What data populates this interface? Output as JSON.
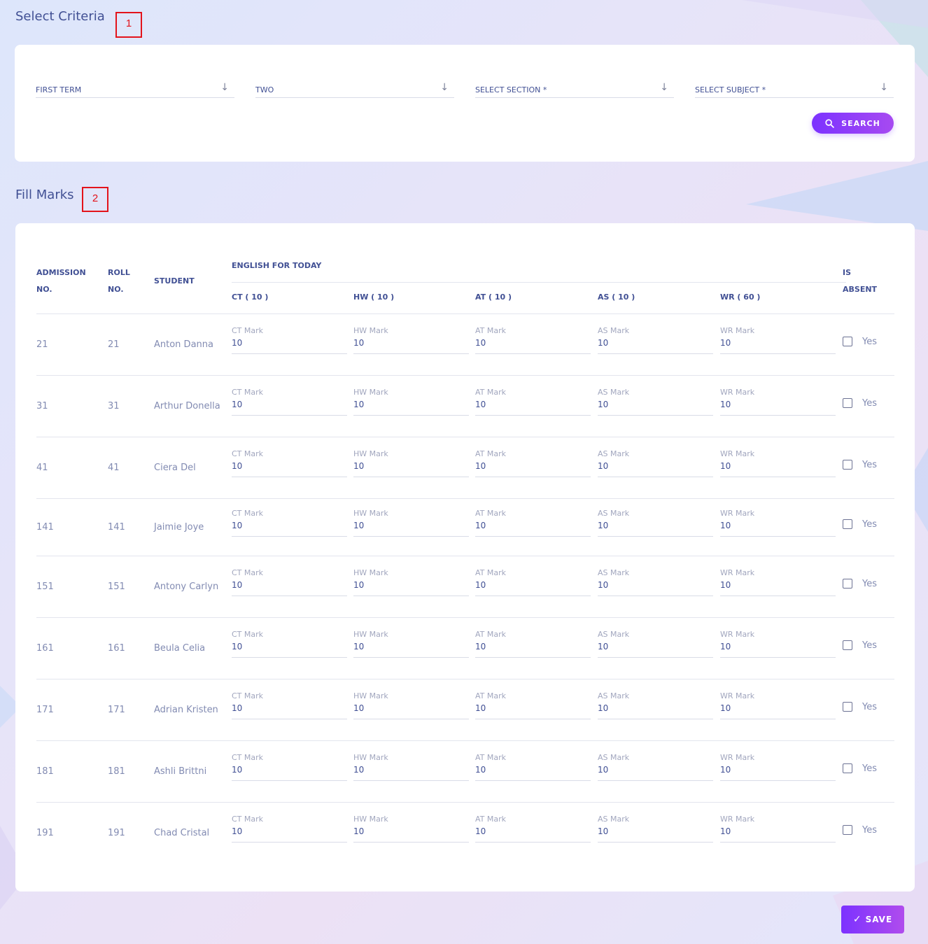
{
  "criteria": {
    "title": "Select Criteria",
    "annotation": "1",
    "exam": "FIRST TERM",
    "class": "TWO",
    "section": "SELECT SECTION *",
    "subject": "SELECT SUBJECT *",
    "search_label": "SEARCH"
  },
  "marks": {
    "title": "Fill Marks",
    "annotation": "2",
    "headers": {
      "admission_line1": "ADMISSION",
      "admission_line2": "NO.",
      "roll_line1": "ROLL",
      "roll_line2": "NO.",
      "student": "STUDENT",
      "subject_group": "ENGLISH FOR TODAY",
      "absent_line1": "IS",
      "absent_line2": "ABSENT",
      "parts": [
        "CT ( 10 )",
        "HW ( 10 )",
        "AT ( 10 )",
        "AS ( 10 )",
        "WR ( 60 )"
      ]
    },
    "part_labels": [
      "CT Mark",
      "HW Mark",
      "AT Mark",
      "AS Mark",
      "WR Mark"
    ],
    "yes_label": "Yes",
    "rows": [
      {
        "admission": "21",
        "roll": "21",
        "student": "Anton Danna",
        "values": [
          "10",
          "10",
          "10",
          "10",
          "10"
        ],
        "absent": false
      },
      {
        "admission": "31",
        "roll": "31",
        "student": "Arthur Donella",
        "values": [
          "10",
          "10",
          "10",
          "10",
          "10"
        ],
        "absent": false
      },
      {
        "admission": "41",
        "roll": "41",
        "student": "Ciera Del",
        "values": [
          "10",
          "10",
          "10",
          "10",
          "10"
        ],
        "absent": false
      },
      {
        "admission": "141",
        "roll": "141",
        "student": "Jaimie Joye",
        "values": [
          "10",
          "10",
          "10",
          "10",
          "10"
        ],
        "absent": false
      },
      {
        "admission": "151",
        "roll": "151",
        "student": "Antony Carlyn",
        "values": [
          "10",
          "10",
          "10",
          "10",
          "10"
        ],
        "absent": false
      },
      {
        "admission": "161",
        "roll": "161",
        "student": "Beula Celia",
        "values": [
          "10",
          "10",
          "10",
          "10",
          "10"
        ],
        "absent": false
      },
      {
        "admission": "171",
        "roll": "171",
        "student": "Adrian Kristen",
        "values": [
          "10",
          "10",
          "10",
          "10",
          "10"
        ],
        "absent": false
      },
      {
        "admission": "181",
        "roll": "181",
        "student": "Ashli Brittni",
        "values": [
          "10",
          "10",
          "10",
          "10",
          "10"
        ],
        "absent": false
      },
      {
        "admission": "191",
        "roll": "191",
        "student": "Chad Cristal",
        "values": [
          "10",
          "10",
          "10",
          "10",
          "10"
        ],
        "absent": false
      }
    ]
  },
  "save_label": "SAVE",
  "colors": {
    "accent_start": "#7c32ff",
    "accent_end": "#a74af1",
    "text_primary": "#415094",
    "text_muted": "#828bb2",
    "annotation": "#e3131b"
  }
}
